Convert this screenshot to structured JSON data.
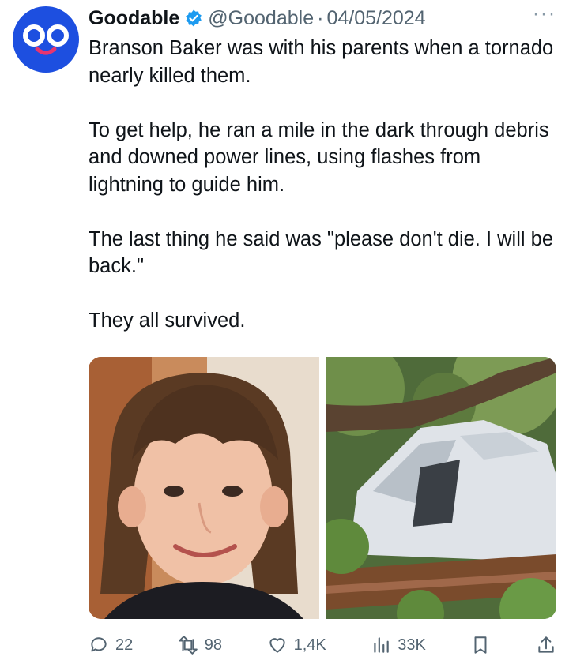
{
  "post": {
    "author_name": "Goodable",
    "handle": "@Goodable",
    "separator": "·",
    "date": "04/05/2024",
    "more_label": "···",
    "paragraphs": [
      "Branson Baker was with his parents when a tornado nearly killed them.",
      "To get help, he ran a mile in the dark through debris and downed power lines, using flashes from lightning to guide him.",
      "The last thing he said was \"please don't die. I will be back.\"",
      "They all survived."
    ]
  },
  "actions": {
    "replies": "22",
    "reposts": "98",
    "likes": "1,4K",
    "views": "33K"
  },
  "colors": {
    "avatar_bg": "#1d4fe0",
    "verified": "#1d9bf0",
    "muted_text": "#536471"
  },
  "icons": [
    "goodable-logo-icon",
    "verified-badge-icon",
    "more-icon",
    "reply-icon",
    "repost-icon",
    "like-icon",
    "views-icon",
    "bookmark-icon",
    "share-icon"
  ]
}
